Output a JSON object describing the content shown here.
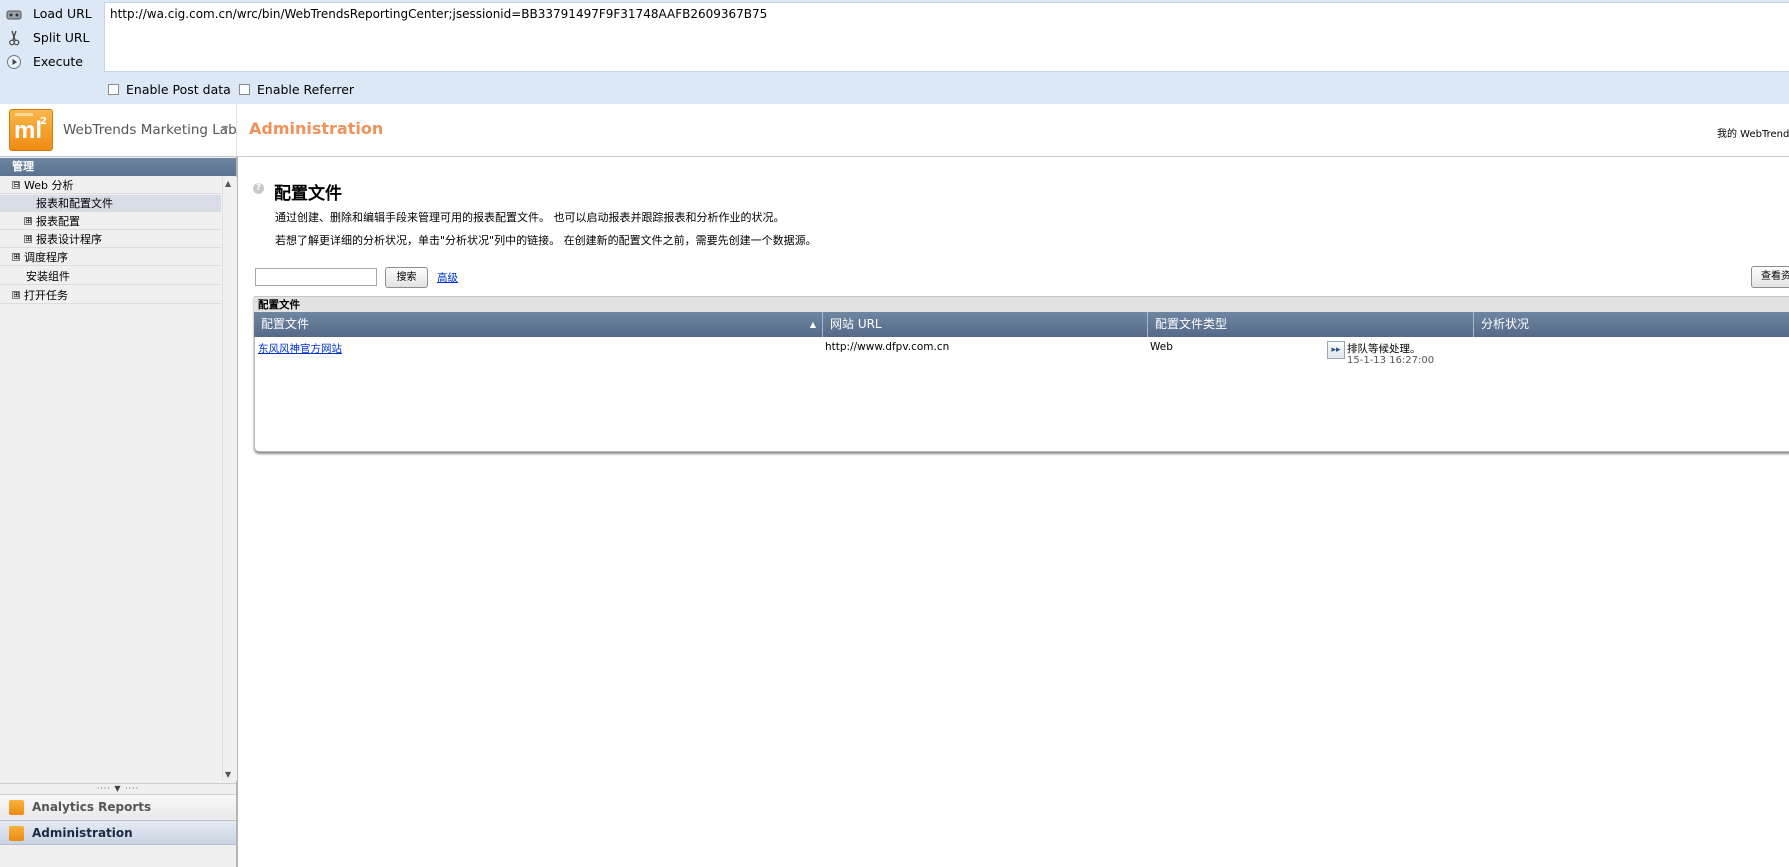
{
  "hackbar": {
    "load_url_label": "Load URL",
    "split_url_label": "Split URL",
    "execute_label": "Execute",
    "url_value": "http://wa.cig.com.cn/wrc/bin/WebTrendsReportingCenter;jsessionid=BB33791497F9F31748AAFB2609367B75",
    "enable_post_label": "Enable Post data",
    "enable_referrer_label": "Enable Referrer"
  },
  "header": {
    "logo_text": "ml",
    "logo_sup": "2",
    "brand_name": "WebTrends Marketing Lab",
    "title": "Administration",
    "right_text": "我的 WebTrends |"
  },
  "sidebar": {
    "heading": "管理",
    "items": [
      {
        "label": "Web 分析",
        "toggle": "⊟"
      },
      {
        "label": "报表和配置文件"
      },
      {
        "label": "报表配置",
        "toggle": "⊞"
      },
      {
        "label": "报表设计程序",
        "toggle": "⊞"
      },
      {
        "label": "调度程序",
        "toggle": "⊞"
      },
      {
        "label": "安装组件"
      },
      {
        "label": "打开任务",
        "toggle": "⊞"
      }
    ],
    "splitter_text": "···· ▼ ····",
    "nav": {
      "analytics_label": "Analytics Reports",
      "admin_label": "Administration"
    }
  },
  "main": {
    "help_icon": "?",
    "title": "配置文件",
    "desc1": "通过创建、删除和编辑手段来管理可用的报表配置文件。 也可以启动报表并跟踪报表和分析作业的状况。",
    "desc2": "若想了解更详细的分析状况，单击\"分析状况\"列中的链接。 在创建新的配置文件之前，需要先创建一个数据源。",
    "search_placeholder": "",
    "search_button": "搜索",
    "advanced_link": "高级",
    "view_all_button": "查看资",
    "panel_title": "配置文件",
    "columns": [
      "配置文件",
      "网站 URL",
      "配置文件类型",
      "分析状况"
    ],
    "rows": [
      {
        "profile": "东风风神官方网站",
        "url": "http://www.dfpv.com.cn",
        "type": "Web",
        "status": "排队等候处理。",
        "status_time": "15-1-13 16:27:00"
      }
    ]
  },
  "colors": {
    "hackbar_bg": "#dce8f5",
    "accent_orange": "#f0925a",
    "grid_header": "#5f7694",
    "link": "#0033cc"
  }
}
